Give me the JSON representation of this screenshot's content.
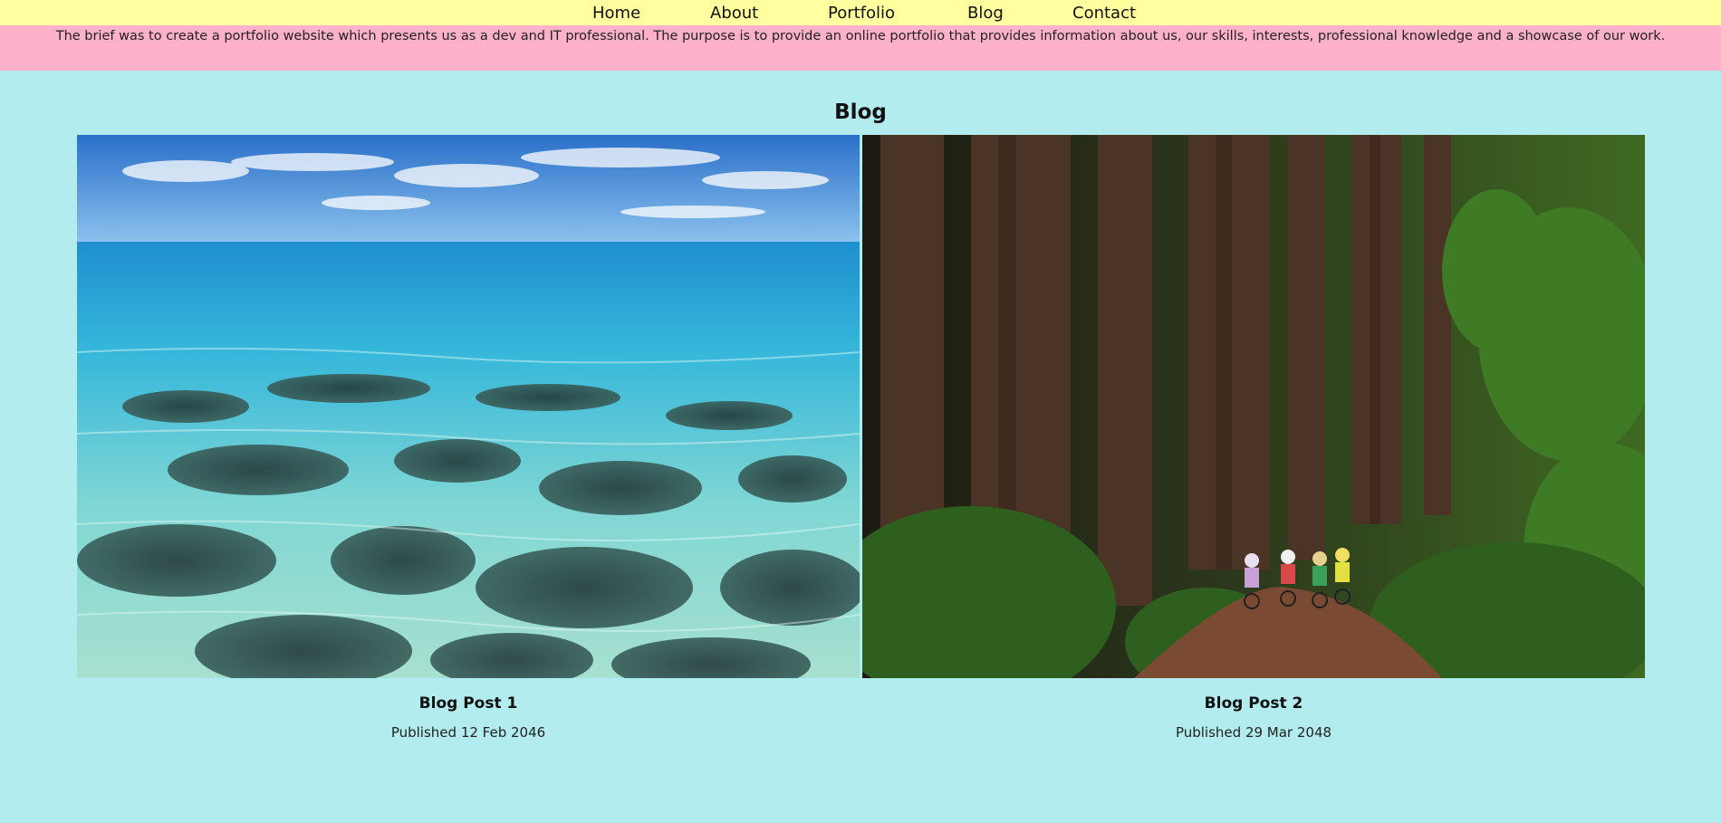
{
  "nav": {
    "items": [
      {
        "label": "Home"
      },
      {
        "label": "About"
      },
      {
        "label": "Portfolio"
      },
      {
        "label": "Blog"
      },
      {
        "label": "Contact"
      }
    ]
  },
  "brief": {
    "text": "The brief was to create a portfolio website which presents us as a dev and IT professional. The purpose is to provide an online portfolio that provides information about us, our skills, interests, professional knowledge and a showcase of our work."
  },
  "blog": {
    "title": "Blog",
    "posts": [
      {
        "title": "Blog Post 1",
        "date": "Published 12 Feb 2046",
        "image": "ocean-reef-photo"
      },
      {
        "title": "Blog Post 2",
        "date": "Published 29 Mar 2048",
        "image": "redwood-forest-cyclists-photo"
      }
    ]
  },
  "colors": {
    "nav_bg": "#ffff9f",
    "brief_bg": "#ffb0cb",
    "page_bg": "#b2ecef"
  }
}
